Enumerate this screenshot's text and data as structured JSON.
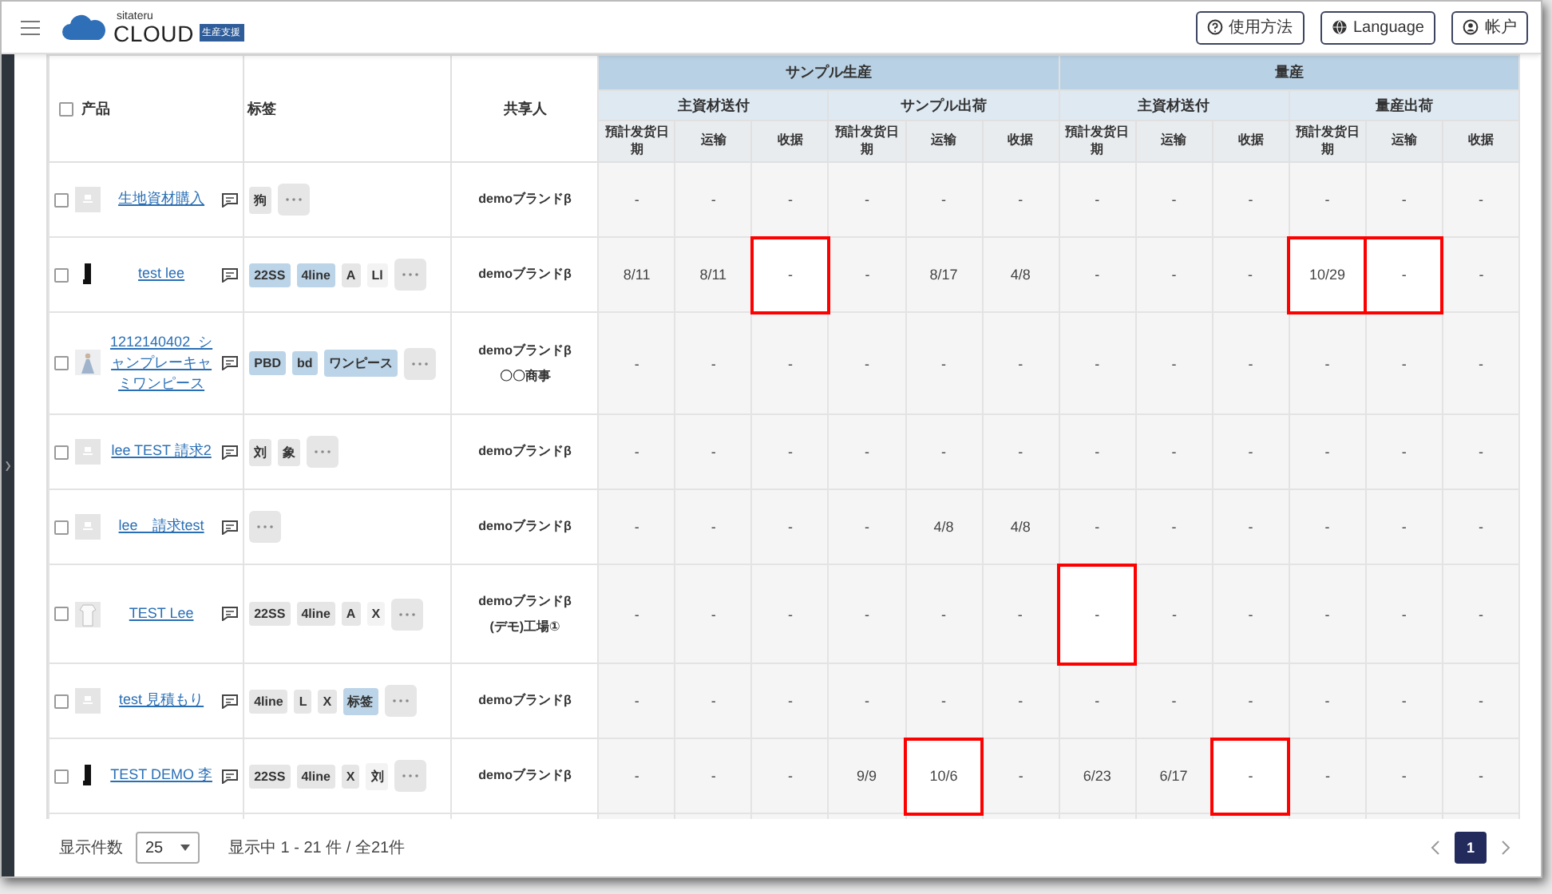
{
  "header": {
    "logo": {
      "small": "sitateru",
      "main": "CLOUD",
      "badge": "生産支援"
    },
    "buttons": [
      {
        "kind": "help",
        "label": "使用方法"
      },
      {
        "kind": "globe",
        "label": "Language"
      },
      {
        "kind": "user",
        "label": "帐户"
      }
    ]
  },
  "table": {
    "select_all": {
      "checked": false
    },
    "columns": {
      "product": "产品",
      "tags": "标签",
      "sharer": "共享人"
    },
    "groups": [
      {
        "label": "サンプル生産",
        "subgroups": [
          {
            "label": "主資材送付",
            "columns": [
              "預計发货日期",
              "运输",
              "收据"
            ]
          },
          {
            "label": "サンプル出荷",
            "columns": [
              "預計发货日期",
              "运输",
              "收据"
            ]
          }
        ]
      },
      {
        "label": "量産",
        "subgroups": [
          {
            "label": "主資材送付",
            "columns": [
              "預計发货日期",
              "运输",
              "收据"
            ]
          },
          {
            "label": "量産出荷",
            "columns": [
              "預計发货日期",
              "运输",
              "收据"
            ]
          }
        ]
      }
    ],
    "rows": [
      {
        "checked": false,
        "thumb": {
          "kind": "placeholder"
        },
        "product": "生地資材購入",
        "tags": [
          {
            "text": "狗",
            "color": "#e6e6e6"
          }
        ],
        "sharer": [
          "demoブランドβ"
        ],
        "cells": [
          {
            "text": "-",
            "highlighted": false
          },
          {
            "text": "-",
            "highlighted": false
          },
          {
            "text": "-",
            "highlighted": false
          },
          {
            "text": "-",
            "highlighted": false
          },
          {
            "text": "-",
            "highlighted": false
          },
          {
            "text": "-",
            "highlighted": false
          },
          {
            "text": "-",
            "highlighted": false
          },
          {
            "text": "-",
            "highlighted": false
          },
          {
            "text": "-",
            "highlighted": false
          },
          {
            "text": "-",
            "highlighted": false
          },
          {
            "text": "-",
            "highlighted": false
          },
          {
            "text": "-",
            "highlighted": false
          }
        ]
      },
      {
        "checked": false,
        "thumb": {
          "kind": "boot"
        },
        "product": "test lee",
        "tags": [
          {
            "text": "22SS",
            "color": "#bcd4e8"
          },
          {
            "text": "4line",
            "color": "#bcd4e8"
          },
          {
            "text": "A",
            "color": "#e6e6e6"
          },
          {
            "text": "Ll",
            "color": "#f3f3f3"
          }
        ],
        "sharer": [
          "demoブランドβ"
        ],
        "cells": [
          {
            "text": "8/11",
            "highlighted": false
          },
          {
            "text": "8/11",
            "highlighted": false
          },
          {
            "text": "-",
            "highlighted": true
          },
          {
            "text": "-",
            "highlighted": false
          },
          {
            "text": "8/17",
            "highlighted": false
          },
          {
            "text": "4/8",
            "highlighted": false
          },
          {
            "text": "-",
            "highlighted": false
          },
          {
            "text": "-",
            "highlighted": false
          },
          {
            "text": "-",
            "highlighted": false
          },
          {
            "text": "10/29",
            "highlighted": true
          },
          {
            "text": "-",
            "highlighted": true
          },
          {
            "text": "-",
            "highlighted": false
          }
        ]
      },
      {
        "checked": false,
        "thumb": {
          "kind": "dress"
        },
        "product": "1212140402_シャンプレーキャミワンピース",
        "tags": [
          {
            "text": "PBD",
            "color": "#bcd4e8"
          },
          {
            "text": "bd",
            "color": "#bcd4e8"
          },
          {
            "text": "ワンピース",
            "color": "#bcd4e8"
          }
        ],
        "sharer": [
          "demoブランドβ",
          "〇〇商事"
        ],
        "cells": [
          {
            "text": "-",
            "highlighted": false
          },
          {
            "text": "-",
            "highlighted": false
          },
          {
            "text": "-",
            "highlighted": false
          },
          {
            "text": "-",
            "highlighted": false
          },
          {
            "text": "-",
            "highlighted": false
          },
          {
            "text": "-",
            "highlighted": false
          },
          {
            "text": "-",
            "highlighted": false
          },
          {
            "text": "-",
            "highlighted": false
          },
          {
            "text": "-",
            "highlighted": false
          },
          {
            "text": "-",
            "highlighted": false
          },
          {
            "text": "-",
            "highlighted": false
          },
          {
            "text": "-",
            "highlighted": false
          }
        ]
      },
      {
        "checked": false,
        "thumb": {
          "kind": "placeholder"
        },
        "product": "lee TEST 請求2",
        "tags": [
          {
            "text": "刘",
            "color": "#e6e6e6"
          },
          {
            "text": "象",
            "color": "#e6e6e6"
          }
        ],
        "sharer": [
          "demoブランドβ"
        ],
        "cells": [
          {
            "text": "-",
            "highlighted": false
          },
          {
            "text": "-",
            "highlighted": false
          },
          {
            "text": "-",
            "highlighted": false
          },
          {
            "text": "-",
            "highlighted": false
          },
          {
            "text": "-",
            "highlighted": false
          },
          {
            "text": "-",
            "highlighted": false
          },
          {
            "text": "-",
            "highlighted": false
          },
          {
            "text": "-",
            "highlighted": false
          },
          {
            "text": "-",
            "highlighted": false
          },
          {
            "text": "-",
            "highlighted": false
          },
          {
            "text": "-",
            "highlighted": false
          },
          {
            "text": "-",
            "highlighted": false
          }
        ]
      },
      {
        "checked": false,
        "thumb": {
          "kind": "placeholder"
        },
        "product": "lee　請求test",
        "tags": [],
        "sharer": [
          "demoブランドβ"
        ],
        "cells": [
          {
            "text": "-",
            "highlighted": false
          },
          {
            "text": "-",
            "highlighted": false
          },
          {
            "text": "-",
            "highlighted": false
          },
          {
            "text": "-",
            "highlighted": false
          },
          {
            "text": "4/8",
            "highlighted": false
          },
          {
            "text": "4/8",
            "highlighted": false
          },
          {
            "text": "-",
            "highlighted": false
          },
          {
            "text": "-",
            "highlighted": false
          },
          {
            "text": "-",
            "highlighted": false
          },
          {
            "text": "-",
            "highlighted": false
          },
          {
            "text": "-",
            "highlighted": false
          },
          {
            "text": "-",
            "highlighted": false
          }
        ]
      },
      {
        "checked": false,
        "thumb": {
          "kind": "shirt"
        },
        "product": "TEST Lee",
        "tags": [
          {
            "text": "22SS",
            "color": "#e6e6e6"
          },
          {
            "text": "4line",
            "color": "#e6e6e6"
          },
          {
            "text": "A",
            "color": "#e6e6e6"
          },
          {
            "text": "X",
            "color": "#f3f3f3"
          }
        ],
        "sharer": [
          "demoブランドβ",
          "(デモ)工場①"
        ],
        "cells": [
          {
            "text": "-",
            "highlighted": false
          },
          {
            "text": "-",
            "highlighted": false
          },
          {
            "text": "-",
            "highlighted": false
          },
          {
            "text": "-",
            "highlighted": false
          },
          {
            "text": "-",
            "highlighted": false
          },
          {
            "text": "-",
            "highlighted": false
          },
          {
            "text": "-",
            "highlighted": true
          },
          {
            "text": "-",
            "highlighted": false
          },
          {
            "text": "-",
            "highlighted": false
          },
          {
            "text": "-",
            "highlighted": false
          },
          {
            "text": "-",
            "highlighted": false
          },
          {
            "text": "-",
            "highlighted": false
          }
        ]
      },
      {
        "checked": false,
        "thumb": {
          "kind": "placeholder"
        },
        "product": "test 見積もり",
        "tags": [
          {
            "text": "4line",
            "color": "#e6e6e6"
          },
          {
            "text": "L",
            "color": "#e6e6e6"
          },
          {
            "text": "X",
            "color": "#e6e6e6"
          },
          {
            "text": "标签",
            "color": "#bcd4e8"
          }
        ],
        "sharer": [
          "demoブランドβ"
        ],
        "cells": [
          {
            "text": "-",
            "highlighted": false
          },
          {
            "text": "-",
            "highlighted": false
          },
          {
            "text": "-",
            "highlighted": false
          },
          {
            "text": "-",
            "highlighted": false
          },
          {
            "text": "-",
            "highlighted": false
          },
          {
            "text": "-",
            "highlighted": false
          },
          {
            "text": "-",
            "highlighted": false
          },
          {
            "text": "-",
            "highlighted": false
          },
          {
            "text": "-",
            "highlighted": false
          },
          {
            "text": "-",
            "highlighted": false
          },
          {
            "text": "-",
            "highlighted": false
          },
          {
            "text": "-",
            "highlighted": false
          }
        ]
      },
      {
        "checked": false,
        "thumb": {
          "kind": "boot"
        },
        "product": "TEST DEMO 李",
        "tags": [
          {
            "text": "22SS",
            "color": "#e6e6e6"
          },
          {
            "text": "4line",
            "color": "#e6e6e6"
          },
          {
            "text": "X",
            "color": "#e6e6e6"
          },
          {
            "text": "刘",
            "color": "#f3f3f3"
          }
        ],
        "sharer": [
          "demoブランドβ"
        ],
        "cells": [
          {
            "text": "-",
            "highlighted": false
          },
          {
            "text": "-",
            "highlighted": false
          },
          {
            "text": "-",
            "highlighted": false
          },
          {
            "text": "9/9",
            "highlighted": false
          },
          {
            "text": "10/6",
            "highlighted": true
          },
          {
            "text": "-",
            "highlighted": false
          },
          {
            "text": "6/23",
            "highlighted": false
          },
          {
            "text": "6/17",
            "highlighted": false
          },
          {
            "text": "-",
            "highlighted": true
          },
          {
            "text": "-",
            "highlighted": false
          },
          {
            "text": "-",
            "highlighted": false
          },
          {
            "text": "-",
            "highlighted": false
          }
        ]
      }
    ]
  },
  "footer": {
    "page_size_label": "显示件数",
    "page_size": "25",
    "summary": "显示中 1 - 21 件 / 全21件",
    "pages": [
      {
        "label": "1",
        "selected": true
      }
    ]
  }
}
